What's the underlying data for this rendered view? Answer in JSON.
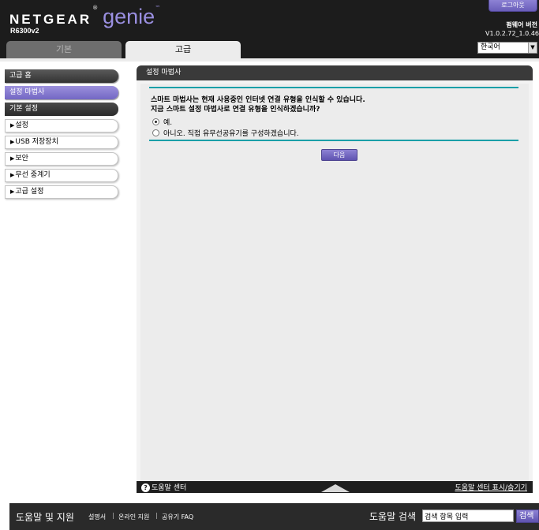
{
  "header": {
    "brand": "NETGEAR",
    "product": "genie",
    "model": "R6300v2",
    "logout_label": "로그아웃",
    "firmware_label": "펌웨어 버전",
    "firmware_version": "V1.0.2.72_1.0.46",
    "language": "한국어",
    "tabs": [
      {
        "label": "기본",
        "active": false
      },
      {
        "label": "고급",
        "active": true
      }
    ]
  },
  "sidebar": {
    "items": [
      {
        "label": "고급 홈"
      },
      {
        "label": "설정 마법사"
      },
      {
        "label": "기본 설정"
      },
      {
        "label": "설정"
      },
      {
        "label": "USB 저장장치"
      },
      {
        "label": "보안"
      },
      {
        "label": "무선 중계기"
      },
      {
        "label": "고급 설정"
      }
    ]
  },
  "panel": {
    "title": "설정 마법사",
    "question_line1": "스마트 마법사는 현재 사용중인 인터넷 연결 유형을 인식할 수 있습니다.",
    "question_line2": "지금 스마트 설정 마법사로 연결 유형을 인식하겠습니까?",
    "option_yes": "예.",
    "option_no": "아니오. 직접 유무선공유기를 구성하겠습니다.",
    "next_button": "다음"
  },
  "help_bar": {
    "left_label": "도움말 센터",
    "right_label": "도움말 센터 표시/숨기기"
  },
  "footer": {
    "title": "도움말 및 지원",
    "links": [
      "설명서",
      "온라인 지원",
      "공유기 FAQ"
    ],
    "search_label": "도움말 검색",
    "search_placeholder": "검색 항목 입력",
    "search_button": "검색"
  },
  "colors": {
    "accent": "#7367c4",
    "rule": "#1a9fa8",
    "header_bg": "#1c1c1c"
  }
}
